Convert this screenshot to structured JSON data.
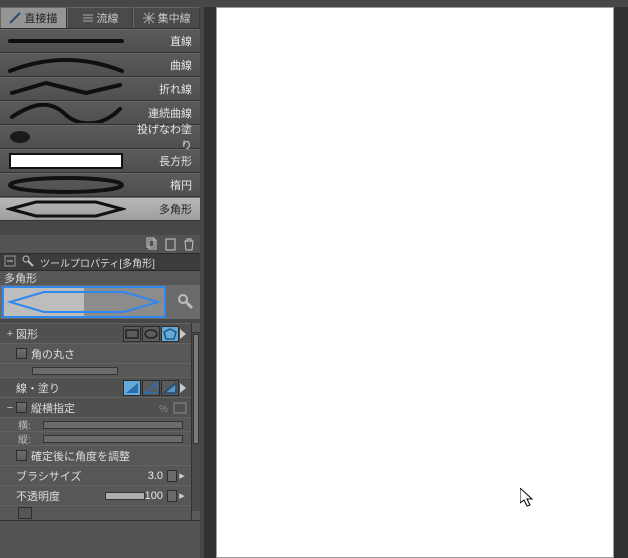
{
  "tabs": {
    "draw": "直接描",
    "stream": "流線",
    "focus": "集中線"
  },
  "tools": {
    "line": "直線",
    "curve": "曲線",
    "polyline": "折れ線",
    "polycurve": "連続曲線",
    "lasso": "投げなわ塗り",
    "rect": "長方形",
    "ellipse": "楕円",
    "polygon": "多角形"
  },
  "property": {
    "header": "ツールプロパティ[多角形]",
    "subtool": "多角形",
    "shape": "図形",
    "roundness": "角の丸さ",
    "line_fill": "線・塗り",
    "aspect": "縦横指定",
    "horiz": "横:",
    "vert": "縦:",
    "adjust_angle": "確定後に角度を調整",
    "brush_size": "ブラシサイズ",
    "brush_value": "3.0",
    "opacity": "不透明度",
    "opacity_value": "100"
  }
}
